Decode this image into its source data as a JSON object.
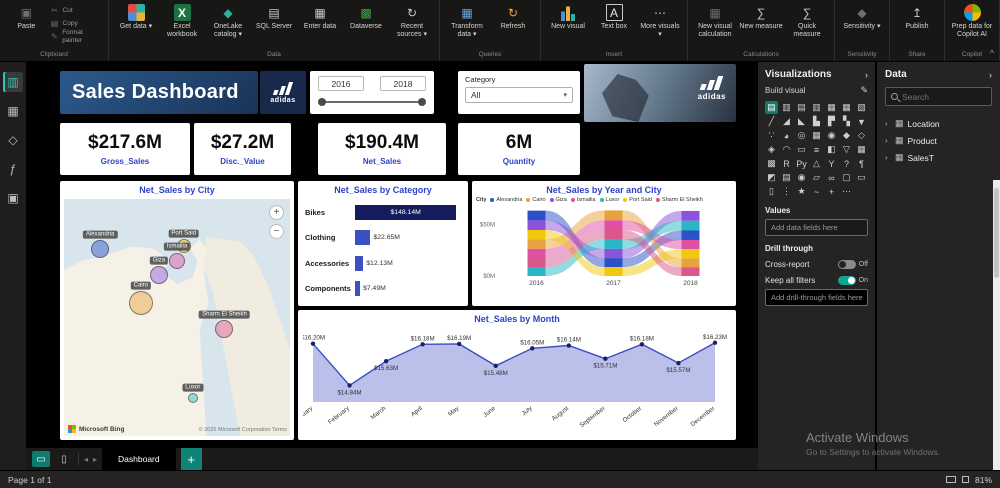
{
  "ribbon": {
    "collapse_glyph": "^",
    "groups": [
      {
        "label": "Clipboard",
        "buttons": [
          {
            "label": "Paste",
            "icon": "paste-icon",
            "glyph": "▣",
            "style": "dim",
            "big": true
          },
          {
            "label": "Cut",
            "icon": "cut-icon",
            "glyph": "✂",
            "style": "dim",
            "big": false
          },
          {
            "label": "Copy",
            "icon": "copy-icon",
            "glyph": "▤",
            "style": "dim",
            "big": false
          },
          {
            "label": "Format painter",
            "icon": "format-painter-icon",
            "glyph": "✎",
            "style": "dim",
            "big": false
          }
        ]
      },
      {
        "label": "Data",
        "buttons": [
          {
            "label": "Get data",
            "icon": "get-data-icon",
            "glyph": "",
            "style": "grid",
            "big": true,
            "dropdown": true
          },
          {
            "label": "Excel workbook",
            "icon": "excel-workbook-icon",
            "glyph": "X",
            "style": "box-green",
            "big": true
          },
          {
            "label": "OneLake catalog",
            "icon": "onelake-catalog-icon",
            "glyph": "◆",
            "style": "teal",
            "big": true,
            "dropdown": true
          },
          {
            "label": "SQL Server",
            "icon": "sql-server-icon",
            "glyph": "▤",
            "style": "plain",
            "big": true
          },
          {
            "label": "Enter data",
            "icon": "enter-data-icon",
            "glyph": "▦",
            "style": "plain",
            "big": true
          },
          {
            "label": "Dataverse",
            "icon": "dataverse-icon",
            "glyph": "▩",
            "style": "green",
            "big": true
          },
          {
            "label": "Recent sources",
            "icon": "recent-sources-icon",
            "glyph": "↻",
            "style": "plain",
            "big": true,
            "dropdown": true
          }
        ]
      },
      {
        "label": "Queries",
        "buttons": [
          {
            "label": "Transform data",
            "icon": "transform-data-icon",
            "glyph": "▦",
            "style": "blue",
            "big": true,
            "dropdown": true
          },
          {
            "label": "Refresh",
            "icon": "refresh-icon",
            "glyph": "↻",
            "style": "yellow",
            "big": true
          }
        ]
      },
      {
        "label": "Insert",
        "buttons": [
          {
            "label": "New visual",
            "icon": "new-visual-icon",
            "glyph": "",
            "style": "chart",
            "big": true
          },
          {
            "label": "Text box",
            "icon": "text-box-icon",
            "glyph": "A",
            "style": "boxed",
            "big": true
          },
          {
            "label": "More visuals",
            "icon": "more-visuals-icon",
            "glyph": "⋯",
            "style": "plain",
            "big": true,
            "dropdown": true
          }
        ]
      },
      {
        "label": "Calculations",
        "buttons": [
          {
            "label": "New visual calculation",
            "icon": "new-visual-calculation-icon",
            "glyph": "▦",
            "style": "dim",
            "big": true
          },
          {
            "label": "New measure",
            "icon": "new-measure-icon",
            "glyph": "∑",
            "style": "plain",
            "big": true
          },
          {
            "label": "Quick measure",
            "icon": "quick-measure-icon",
            "glyph": "∑",
            "style": "plain",
            "big": true
          }
        ]
      },
      {
        "label": "Sensitivity",
        "buttons": [
          {
            "label": "Sensitivity",
            "icon": "sensitivity-icon",
            "glyph": "◆",
            "style": "dim",
            "big": true,
            "dropdown": true
          }
        ]
      },
      {
        "label": "Share",
        "buttons": [
          {
            "label": "Publish",
            "icon": "publish-icon",
            "glyph": "↥",
            "style": "plain",
            "big": true
          }
        ]
      },
      {
        "label": "Copilot",
        "buttons": [
          {
            "label": "Prep data for Copilot AI",
            "icon": "copilot-icon",
            "glyph": "",
            "style": "copilot",
            "big": true
          }
        ]
      }
    ]
  },
  "sidenav": {
    "items": [
      {
        "name": "report-view",
        "glyph": "▥",
        "active": true
      },
      {
        "name": "table-view",
        "glyph": "▦",
        "active": false
      },
      {
        "name": "model-view",
        "glyph": "◇",
        "active": false
      },
      {
        "name": "dax-query-view",
        "glyph": "ƒ",
        "active": false
      },
      {
        "name": "report-builder-view",
        "glyph": "▣",
        "active": false
      }
    ]
  },
  "report": {
    "title": "Sales Dashboard",
    "brand": "adidas",
    "year_slicer": {
      "start": "2016",
      "end": "2018"
    },
    "category_slicer": {
      "label": "Category",
      "value": "All",
      "caret": "▾"
    },
    "kpis": [
      {
        "value": "$217.6M",
        "label": "Gross_Sales"
      },
      {
        "value": "$27.2M",
        "label": "Disc._Value"
      },
      {
        "value": "$190.4M",
        "label": "Net_Sales"
      },
      {
        "value": "6M",
        "label": "Quantity"
      }
    ]
  },
  "map": {
    "title": "Net_Sales by City",
    "provider": "Microsoft Bing",
    "attribution": "© 2025 Microsoft Corporation Terms",
    "zoom_in": "+",
    "zoom_out": "−",
    "bubbles": [
      {
        "city": "Alexandria",
        "x": 16,
        "y": 21,
        "r": 9,
        "color": "#2b50c8"
      },
      {
        "city": "Port Said",
        "x": 53,
        "y": 20,
        "r": 7,
        "color": "#f2c80f"
      },
      {
        "city": "Ismailia",
        "x": 50,
        "y": 26,
        "r": 8,
        "color": "#e04fa3"
      },
      {
        "city": "Giza",
        "x": 42,
        "y": 32,
        "r": 9,
        "color": "#8c52d9"
      },
      {
        "city": "Cairo",
        "x": 34,
        "y": 44,
        "r": 12,
        "color": "#e8a23c"
      },
      {
        "city": "Sharm El Sheikh",
        "x": 71,
        "y": 55,
        "r": 9,
        "color": "#d9578c"
      },
      {
        "city": "Luxor",
        "x": 57,
        "y": 84,
        "r": 5,
        "color": "#29b6c5"
      }
    ]
  },
  "chart_data": [
    {
      "type": "bar",
      "orientation": "horizontal",
      "title": "Net_Sales by Category",
      "categories": [
        "Bikes",
        "Clothing",
        "Accessories",
        "Components"
      ],
      "values": [
        148.14,
        22.65,
        12.13,
        7.49
      ],
      "labels": [
        "$148.14M",
        "$22.65M",
        "$12.13M",
        "$7.49M"
      ],
      "xlim": [
        0,
        155
      ],
      "unit": "$M"
    },
    {
      "type": "bar",
      "subtype": "ribbon-stacked",
      "title": "Net_Sales by Year and City",
      "legend_title": "City",
      "legend_position": "top",
      "categories": [
        "2016",
        "2017",
        "2018"
      ],
      "series": [
        {
          "name": "Alexandria",
          "color": "#2b50c8",
          "values": [
            9.5,
            8.8,
            9.2
          ]
        },
        {
          "name": "Cairo",
          "color": "#e8a23c",
          "values": [
            9.1,
            9.6,
            8.8
          ]
        },
        {
          "name": "Giza",
          "color": "#8c52d9",
          "values": [
            9.3,
            8.9,
            9.6
          ]
        },
        {
          "name": "Ismailia",
          "color": "#e04fa3",
          "values": [
            8.9,
            9.4,
            9.0
          ]
        },
        {
          "name": "Luxor",
          "color": "#29b6c5",
          "values": [
            8.7,
            9.1,
            9.4
          ]
        },
        {
          "name": "Port Said",
          "color": "#f2c80f",
          "values": [
            9.2,
            8.6,
            8.9
          ]
        },
        {
          "name": "Sharm El Sheikh",
          "color": "#d9578c",
          "values": [
            8.8,
            9.3,
            8.3
          ]
        }
      ],
      "ylim": [
        0,
        68
      ],
      "yticks": [
        {
          "label": "$50M",
          "value": 50
        },
        {
          "label": "$0M",
          "value": 0
        }
      ],
      "unit": "$M"
    },
    {
      "type": "area",
      "title": "Net_Sales by Month",
      "x": [
        "January",
        "February",
        "March",
        "April",
        "May",
        "June",
        "July",
        "August",
        "September",
        "October",
        "November",
        "December"
      ],
      "values": [
        16.2,
        14.84,
        15.63,
        16.18,
        16.19,
        15.48,
        16.05,
        16.14,
        15.71,
        16.18,
        15.57,
        16.23
      ],
      "labels": [
        "$16.20M",
        "$14.84M",
        "$15.63M",
        "$16.18M",
        "$16.19M",
        "$15.48M",
        "$16.05M",
        "$16.14M",
        "$15.71M",
        "$16.18M",
        "$15.57M",
        "$16.23M"
      ],
      "ylim": [
        14.3,
        16.45
      ],
      "line_color": "#3d4fc0",
      "fill_color": "rgba(130,140,215,0.55)",
      "marker_color": "#1a2066",
      "unit": "$M"
    }
  ],
  "viz_pane": {
    "title": "Visualizations",
    "collapse_icon": "›",
    "build_label": "Build visual",
    "format_icon": "✎",
    "values_label": "Values",
    "values_placeholder": "Add data fields here",
    "drill_label": "Drill through",
    "cross_report": {
      "label": "Cross-report",
      "state": "Off"
    },
    "keep_filters": {
      "label": "Keep all filters",
      "state": "On"
    },
    "drill_placeholder": "Add drill-through fields here",
    "gallery": [
      {
        "name": "stacked-bar-chart",
        "glyph": "▤",
        "selected": true
      },
      {
        "name": "stacked-column-chart",
        "glyph": "▥"
      },
      {
        "name": "clustered-bar-chart",
        "glyph": "▤"
      },
      {
        "name": "clustered-column-chart",
        "glyph": "▥"
      },
      {
        "name": "100-stacked-bar-chart",
        "glyph": "▦"
      },
      {
        "name": "100-stacked-column-chart",
        "glyph": "▦"
      },
      {
        "name": "ribbon-chart",
        "glyph": "▧"
      },
      {
        "name": "line-chart",
        "glyph": "╱"
      },
      {
        "name": "area-chart",
        "glyph": "◢"
      },
      {
        "name": "stacked-area-chart",
        "glyph": "◣"
      },
      {
        "name": "line-and-stacked-column-chart",
        "glyph": "▙"
      },
      {
        "name": "line-and-clustered-column-chart",
        "glyph": "▛"
      },
      {
        "name": "waterfall-chart",
        "glyph": "▚"
      },
      {
        "name": "funnel-chart",
        "glyph": "▼"
      },
      {
        "name": "scatter-chart",
        "glyph": "∵"
      },
      {
        "name": "pie-chart",
        "glyph": "◕"
      },
      {
        "name": "donut-chart",
        "glyph": "◎"
      },
      {
        "name": "treemap",
        "glyph": "▦"
      },
      {
        "name": "map",
        "glyph": "◉"
      },
      {
        "name": "filled-map",
        "glyph": "◆"
      },
      {
        "name": "shape-map",
        "glyph": "◇"
      },
      {
        "name": "azure-map",
        "glyph": "◈"
      },
      {
        "name": "gauge",
        "glyph": "◠"
      },
      {
        "name": "card",
        "glyph": "▭"
      },
      {
        "name": "multi-row-card",
        "glyph": "≡"
      },
      {
        "name": "kpi",
        "glyph": "◧"
      },
      {
        "name": "slicer",
        "glyph": "▽"
      },
      {
        "name": "table",
        "glyph": "▦"
      },
      {
        "name": "matrix",
        "glyph": "▩"
      },
      {
        "name": "r-script-visual",
        "glyph": "R"
      },
      {
        "name": "python-visual",
        "glyph": "Py"
      },
      {
        "name": "key-influencers",
        "glyph": "△"
      },
      {
        "name": "decomposition-tree",
        "glyph": "Y"
      },
      {
        "name": "qa-visual",
        "glyph": "?"
      },
      {
        "name": "smart-narrative",
        "glyph": "¶"
      },
      {
        "name": "metrics",
        "glyph": "◩"
      },
      {
        "name": "paginated-report",
        "glyph": "▤"
      },
      {
        "name": "arcgis-map",
        "glyph": "◉"
      },
      {
        "name": "power-apps",
        "glyph": "▱"
      },
      {
        "name": "power-automate",
        "glyph": "∞"
      },
      {
        "name": "button-slicer",
        "glyph": "▢"
      },
      {
        "name": "text-slicer",
        "glyph": "▭"
      },
      {
        "name": "new-card",
        "glyph": "▯"
      },
      {
        "name": "hierarchy-slicer",
        "glyph": "⋮"
      },
      {
        "name": "scorecard",
        "glyph": "★"
      },
      {
        "name": "sparkline",
        "glyph": "~"
      },
      {
        "name": "custom-visual",
        "glyph": "+"
      },
      {
        "name": "more-options",
        "glyph": "⋯"
      }
    ]
  },
  "data_pane": {
    "title": "Data",
    "collapse_icon": "›",
    "search_placeholder": "Search",
    "tables": [
      {
        "name": "Location"
      },
      {
        "name": "Product"
      },
      {
        "name": "SalesT"
      }
    ]
  },
  "tab_bar": {
    "desktop_glyph": "▭",
    "mobile_glyph": "▯",
    "prev": "◂",
    "next": "▸",
    "page_tab": "Dashboard",
    "new_page": "+"
  },
  "status": {
    "left": "Page 1 of 1",
    "zoom": "81%"
  },
  "watermark": {
    "line1": "Activate Windows",
    "line2": "Go to Settings to activate Windows."
  }
}
